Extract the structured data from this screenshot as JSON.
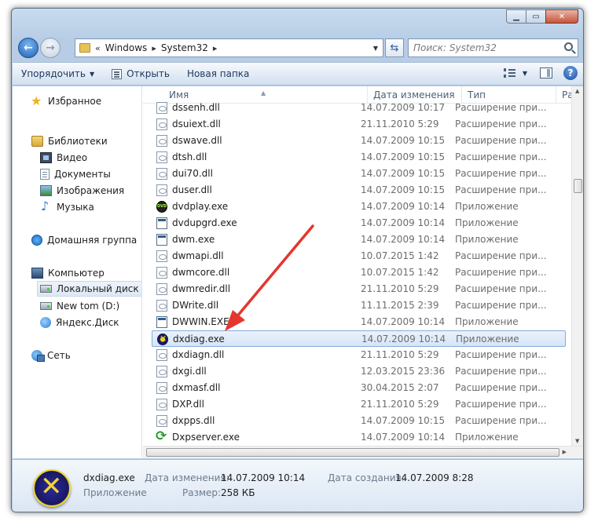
{
  "address": {
    "chevron": "«",
    "crumbs": [
      "Windows",
      "System32"
    ]
  },
  "search": {
    "placeholder": "Поиск: System32"
  },
  "toolbar": {
    "organize": "Упорядочить",
    "open": "Открыть",
    "new_folder": "Новая папка"
  },
  "nav_pane": {
    "favorites": "Избранное",
    "libraries": "Библиотеки",
    "video": "Видео",
    "documents": "Документы",
    "images": "Изображения",
    "music": "Музыка",
    "homegroup": "Домашняя группа",
    "computer": "Компьютер",
    "local_disk": "Локальный диск (C",
    "new_tom": "New tom (D:)",
    "yandex": "Яндекс.Диск",
    "network": "Сеть"
  },
  "columns": {
    "name": "Имя",
    "date": "Дата изменения",
    "type": "Тип",
    "size": "Раз"
  },
  "files": [
    {
      "name": "dssenh.dll",
      "date": "14.07.2009 10:17",
      "type": "Расширение при...",
      "icon": "dll-icon"
    },
    {
      "name": "dsuiext.dll",
      "date": "21.11.2010 5:29",
      "type": "Расширение при...",
      "icon": "dll-icon"
    },
    {
      "name": "dswave.dll",
      "date": "14.07.2009 10:15",
      "type": "Расширение при...",
      "icon": "dll-icon"
    },
    {
      "name": "dtsh.dll",
      "date": "14.07.2009 10:15",
      "type": "Расширение при...",
      "icon": "dll-icon"
    },
    {
      "name": "dui70.dll",
      "date": "14.07.2009 10:15",
      "type": "Расширение при...",
      "icon": "dll-icon"
    },
    {
      "name": "duser.dll",
      "date": "14.07.2009 10:15",
      "type": "Расширение при...",
      "icon": "dll-icon"
    },
    {
      "name": "dvdplay.exe",
      "date": "14.07.2009 10:14",
      "type": "Приложение",
      "icon": "dvd-icon"
    },
    {
      "name": "dvdupgrd.exe",
      "date": "14.07.2009 10:14",
      "type": "Приложение",
      "icon": "exe-icon"
    },
    {
      "name": "dwm.exe",
      "date": "14.07.2009 10:14",
      "type": "Приложение",
      "icon": "exe-icon"
    },
    {
      "name": "dwmapi.dll",
      "date": "10.07.2015 1:42",
      "type": "Расширение при...",
      "icon": "dll-icon"
    },
    {
      "name": "dwmcore.dll",
      "date": "10.07.2015 1:42",
      "type": "Расширение при...",
      "icon": "dll-icon"
    },
    {
      "name": "dwmredir.dll",
      "date": "21.11.2010 5:29",
      "type": "Расширение при...",
      "icon": "dll-icon"
    },
    {
      "name": "DWrite.dll",
      "date": "11.11.2015 2:39",
      "type": "Расширение при...",
      "icon": "dll-icon"
    },
    {
      "name": "DWWIN.EXE",
      "date": "14.07.2009 10:14",
      "type": "Приложение",
      "icon": "exe-icon"
    },
    {
      "name": "dxdiag.exe",
      "date": "14.07.2009 10:14",
      "type": "Приложение",
      "icon": "directx-icon"
    },
    {
      "name": "dxdiagn.dll",
      "date": "21.11.2010 5:29",
      "type": "Расширение при...",
      "icon": "dll-icon"
    },
    {
      "name": "dxgi.dll",
      "date": "12.03.2015 23:36",
      "type": "Расширение при...",
      "icon": "dll-icon"
    },
    {
      "name": "dxmasf.dll",
      "date": "30.04.2015 2:07",
      "type": "Расширение при...",
      "icon": "dll-icon"
    },
    {
      "name": "DXP.dll",
      "date": "21.11.2010 5:29",
      "type": "Расширение при...",
      "icon": "dll-icon"
    },
    {
      "name": "dxpps.dll",
      "date": "14.07.2009 10:15",
      "type": "Расширение при...",
      "icon": "dll-icon"
    },
    {
      "name": "Dxpserver.exe",
      "date": "14.07.2009 10:14",
      "type": "Приложение",
      "icon": "sync-icon"
    }
  ],
  "details": {
    "name": "dxdiag.exe",
    "type": "Приложение",
    "modified_label": "Дата изменения:",
    "modified_value": "14.07.2009 10:14",
    "size_label": "Размер:",
    "size_value": "258 КБ",
    "created_label": "Дата создания:",
    "created_value": "14.07.2009 8:28"
  },
  "accent_color": "#e4362e"
}
